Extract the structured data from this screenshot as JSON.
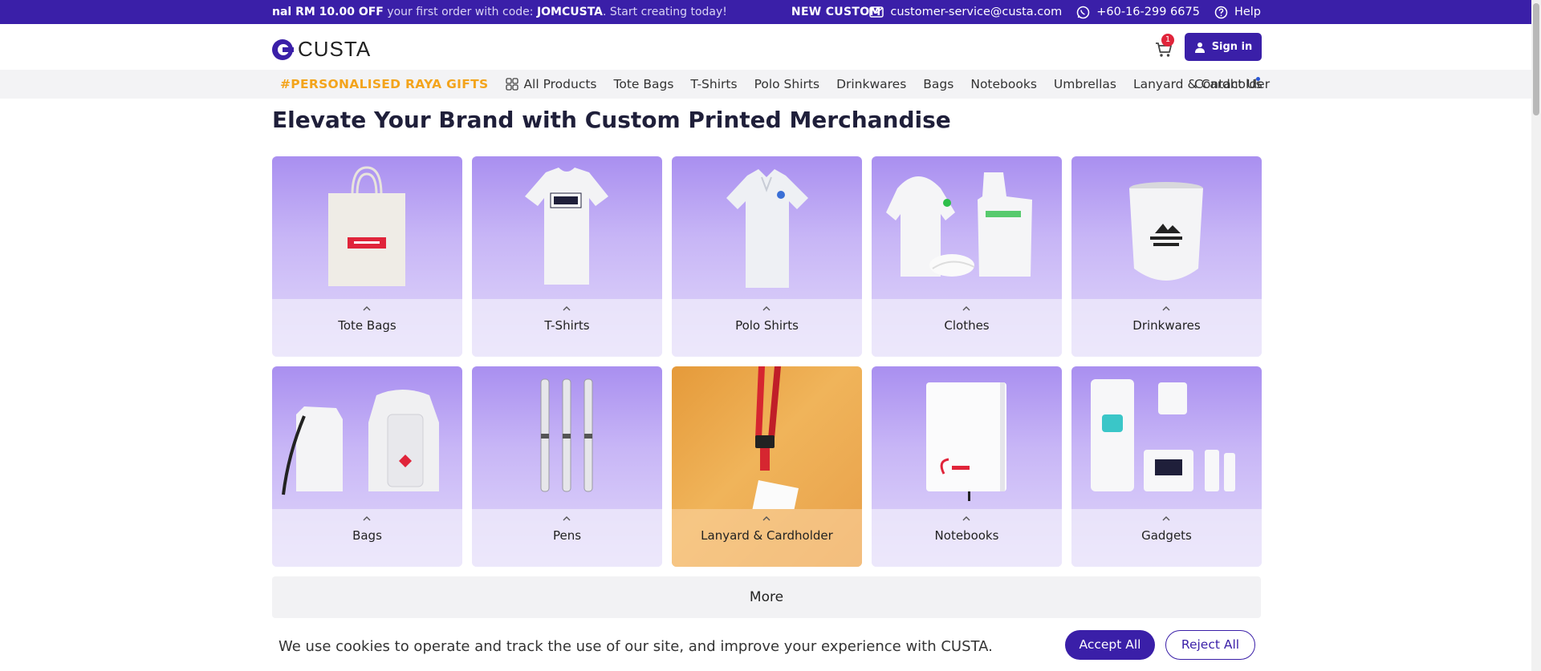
{
  "topbar": {
    "promo_prefix": "nal ",
    "promo_amount": "RM 10.00 OFF",
    "promo_mid": " your first order with code: ",
    "promo_code": "JOMCUSTA",
    "promo_end": ". Start creating today!",
    "promo_offer": "NEW CUSTOMER OFFER! G",
    "email": "customer-service@custa.com",
    "phone": "+60-16-299 6675",
    "help": "Help"
  },
  "header": {
    "logo_text": "CUSTA",
    "cart_count": "1",
    "signin_label": "Sign in"
  },
  "nav": {
    "raya": "#PERSONALISED RAYA GIFTS",
    "all_products": "All Products",
    "links": [
      "Tote Bags",
      "T-Shirts",
      "Polo Shirts",
      "Drinkwares",
      "Bags",
      "Notebooks",
      "Umbrellas",
      "Lanyard & Cardholder"
    ],
    "contact_us": "Contact Us"
  },
  "page": {
    "title": "Elevate Your Brand with Custom Printed Merchandise"
  },
  "categories": [
    {
      "label": "Tote Bags",
      "icon": "tote-bag-image"
    },
    {
      "label": "T-Shirts",
      "icon": "tshirt-image"
    },
    {
      "label": "Polo Shirts",
      "icon": "polo-shirt-image"
    },
    {
      "label": "Clothes",
      "icon": "clothes-image"
    },
    {
      "label": "Drinkwares",
      "icon": "tumbler-image"
    },
    {
      "label": "Bags",
      "icon": "backpack-image"
    },
    {
      "label": "Pens",
      "icon": "pens-image"
    },
    {
      "label": "Lanyard & Cardholder",
      "icon": "lanyard-image"
    },
    {
      "label": "Notebooks",
      "icon": "notebook-image"
    },
    {
      "label": "Gadgets",
      "icon": "gadgets-image"
    }
  ],
  "more_label": "More",
  "cookie": {
    "text": "We use cookies to operate and track the use of our site, and improve your experience with CUSTA.",
    "accept": "Accept All",
    "reject": "Reject All"
  },
  "colors": {
    "brand": "#3a1fa8",
    "raya": "#f3a41c",
    "badge": "#e0243a"
  }
}
